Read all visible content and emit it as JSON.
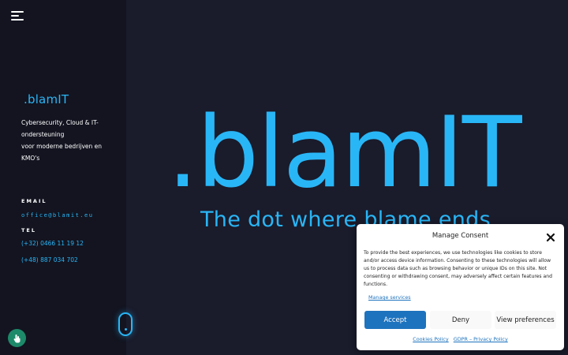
{
  "sidebar": {
    "logo": ".blamIT",
    "tagline_line1": "Cybersecurity, Cloud & IT-",
    "tagline_line2": "ondersteuning",
    "tagline_line3": "voor moderne bedrijven en",
    "tagline_line4": "KMO's",
    "email_label": "EMAIL",
    "email": "office@blamit.eu",
    "tel_label": "TEL",
    "phone1": "(+32) 0466 11 19 12",
    "phone2": "(+48) 887 034 702"
  },
  "hero": {
    "title": ".blamIT",
    "subtitle": "The dot where blame ends"
  },
  "consent": {
    "title": "Manage Consent",
    "text": "To provide the best experiences, we use technologies like cookies to store and/or access device information. Consenting to these technologies will allow us to process data such as browsing behavior or unique IDs on this site. Not consenting or withdrawing consent, may adversely affect certain features and functions.",
    "manage_link": "Manage services",
    "accept": "Accept",
    "deny": "Deny",
    "preferences": "View preferences",
    "cookies_policy": "Cookies Policy",
    "privacy_policy": "GDPR – Privacy Policy"
  },
  "colors": {
    "accent": "#29b6f6",
    "background": "#1a1b2b",
    "sidebar": "#131420",
    "button_primary": "#1e73be",
    "a11y_button": "#1d8a6a"
  },
  "icons": {
    "menu": "hamburger-menu-icon",
    "close": "close-icon",
    "accessibility": "hand-pointer-icon",
    "scroll": "mouse-scroll-icon"
  }
}
